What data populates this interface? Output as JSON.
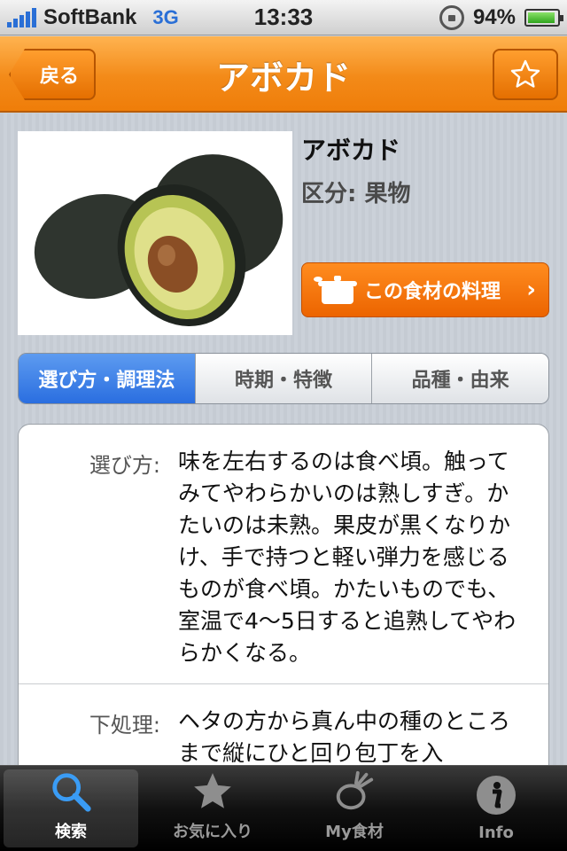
{
  "status_bar": {
    "carrier": "SoftBank",
    "network": "3G",
    "time": "13:33",
    "battery": "94%"
  },
  "nav": {
    "back_label": "戻る",
    "title": "アボカド",
    "favorite_icon": "star-outline-icon"
  },
  "food": {
    "name": "アボカド",
    "category": "区分: 果物",
    "recipe_button": "この食材の料理"
  },
  "segments": [
    {
      "label": "選び方・調理法",
      "active": true
    },
    {
      "label": "時期・特徴",
      "active": false
    },
    {
      "label": "品種・由来",
      "active": false
    }
  ],
  "details": [
    {
      "label": "選び方:",
      "text": "味を左右するのは食べ頃。触ってみてやわらかいのは熟しすぎ。かたいのは未熟。果皮が黒くなりかけ、手で持つと軽い弾力を感じるものが食べ頃。かたいものでも、室温で4〜5日すると追熟してやわらかくなる。"
    },
    {
      "label": "下処理:",
      "text": "ヘタの方から真ん中の種のところまで縦にひと回り包丁を入"
    }
  ],
  "tabs": [
    {
      "label": "検索",
      "icon": "magnifier-icon",
      "active": true
    },
    {
      "label": "お気に入り",
      "icon": "star-icon",
      "active": false
    },
    {
      "label": "My食材",
      "icon": "vegetable-icon",
      "active": false
    },
    {
      "label": "Info",
      "icon": "info-icon",
      "active": false
    }
  ],
  "colors": {
    "accent_orange": "#f38a18",
    "segment_active": "#2a6ee0",
    "tab_active_icon": "#3a9cf5"
  }
}
